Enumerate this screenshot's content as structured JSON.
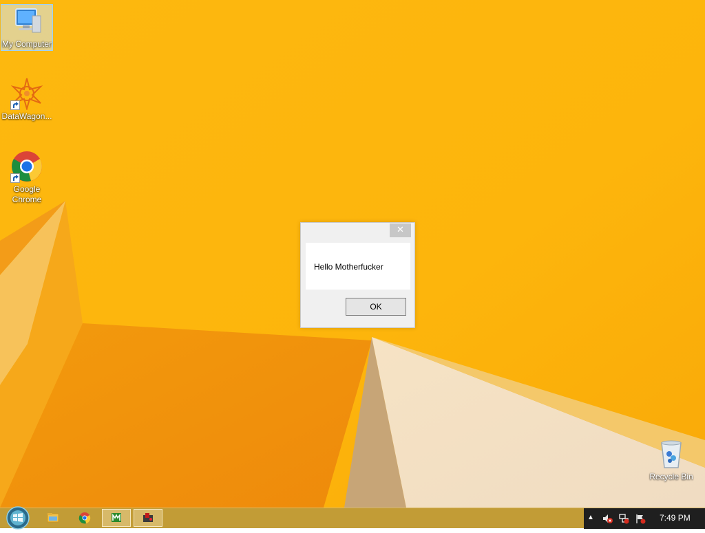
{
  "desktop": {
    "icons": [
      {
        "label": "My Computer",
        "icon": "computer-icon"
      },
      {
        "label": "DataWagon...",
        "icon": "datawagon-icon"
      },
      {
        "label": "Google Chrome",
        "icon": "chrome-icon"
      },
      {
        "label": "Recycle Bin",
        "icon": "recycle-bin-icon"
      }
    ]
  },
  "dialog": {
    "message": "Hello Motherfucker",
    "ok_label": "OK",
    "close_glyph": "✕"
  },
  "taskbar": {
    "start_icon": "windows-orb-icon",
    "pinned": [
      {
        "name": "file-explorer",
        "icon": "folder-icon"
      },
      {
        "name": "chrome",
        "icon": "chrome-icon"
      },
      {
        "name": "app-green",
        "icon": "green-app-icon"
      },
      {
        "name": "app-red",
        "icon": "red-app-icon"
      }
    ],
    "tray": {
      "chevron": "▲",
      "clock": "7:49 PM"
    }
  },
  "colors": {
    "wallpaper_primary": "#fbb40c",
    "wallpaper_dark": "#f08a0a",
    "taskbar": "#c29c36",
    "tray_bg": "#1f1f1f"
  }
}
